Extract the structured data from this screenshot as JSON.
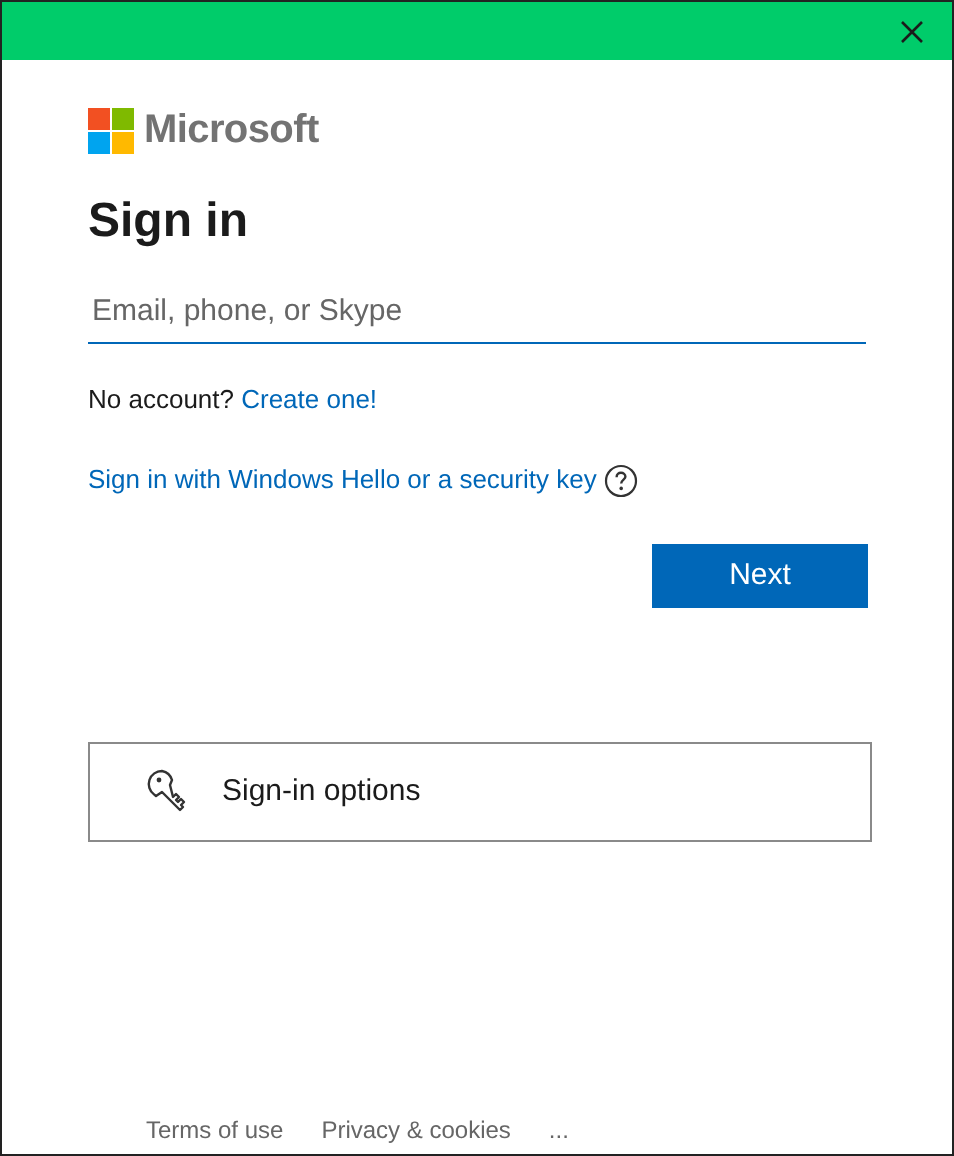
{
  "brand": {
    "name": "Microsoft"
  },
  "heading": "Sign in",
  "email_field": {
    "placeholder": "Email, phone, or Skype"
  },
  "no_account": {
    "text": "No account?",
    "link": "Create one!"
  },
  "hello_link": "Sign in with Windows Hello or a security key",
  "next_button": "Next",
  "sign_in_options": "Sign-in options",
  "footer": [
    "Terms of use",
    "Privacy & cookies",
    "..."
  ]
}
